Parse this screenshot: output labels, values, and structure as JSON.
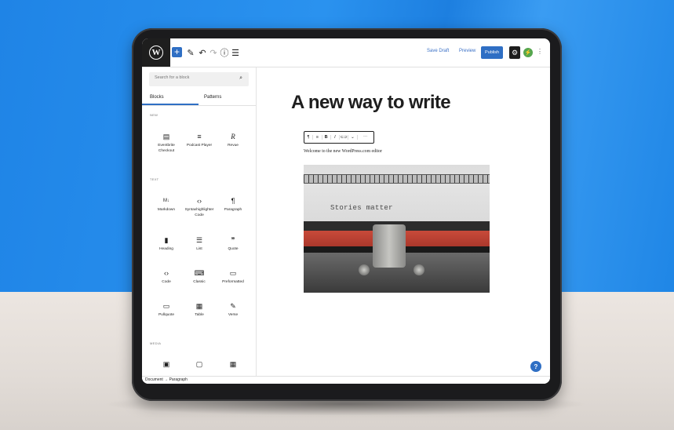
{
  "toolbar": {
    "save_draft_label": "Save Draft",
    "preview_label": "Preview",
    "publish_label": "Publish"
  },
  "inserter": {
    "search_placeholder": "Search for a block",
    "tabs": [
      "Blocks",
      "Patterns"
    ],
    "categories": [
      {
        "label": "NEW",
        "blocks": [
          {
            "icon": "form-icon",
            "glyph": "▤",
            "label": "Eventbrite Checkout"
          },
          {
            "icon": "podcast-icon",
            "glyph": "≡",
            "label": "Podcast Player"
          },
          {
            "icon": "revue-icon",
            "glyph": "R",
            "label": "Revue"
          }
        ]
      },
      {
        "label": "TEXT",
        "blocks": [
          {
            "icon": "markdown-icon",
            "glyph": "M↓",
            "label": "Markdown"
          },
          {
            "icon": "code-brackets-icon",
            "glyph": "‹›",
            "label": "Syntaxhighlighter Code"
          },
          {
            "icon": "paragraph-icon",
            "glyph": "¶",
            "label": "Paragraph"
          },
          {
            "icon": "bookmark-icon",
            "glyph": "▮",
            "label": "Heading"
          },
          {
            "icon": "list-icon",
            "glyph": "☰",
            "label": "List"
          },
          {
            "icon": "quote-icon",
            "glyph": "❞",
            "label": "Quote"
          },
          {
            "icon": "code-icon",
            "glyph": "‹›",
            "label": "Code"
          },
          {
            "icon": "keyboard-icon",
            "glyph": "⌨",
            "label": "Classic"
          },
          {
            "icon": "preformatted-icon",
            "glyph": "▭",
            "label": "Preformatted"
          },
          {
            "icon": "pullquote-icon",
            "glyph": "▭",
            "label": "Pullquote"
          },
          {
            "icon": "table-icon",
            "glyph": "▦",
            "label": "Table"
          },
          {
            "icon": "verse-icon",
            "glyph": "✎",
            "label": "Verse"
          }
        ]
      },
      {
        "label": "MEDIA",
        "blocks": [
          {
            "icon": "image-icon",
            "glyph": "▣",
            "label": ""
          },
          {
            "icon": "media-text-icon",
            "glyph": "▢",
            "label": ""
          },
          {
            "icon": "gallery-icon",
            "glyph": "▦",
            "label": ""
          }
        ]
      }
    ]
  },
  "editor": {
    "title": "A new way to write",
    "paragraph": "Welcome to the new WordPress.com editor",
    "image_typed_text": "Stories matter"
  },
  "statusbar": {
    "breadcrumb": "Document → Paragraph"
  },
  "colors": {
    "accent": "#2f6fc4",
    "background_blue": "#1f86e6",
    "surface": "#ffffff"
  }
}
